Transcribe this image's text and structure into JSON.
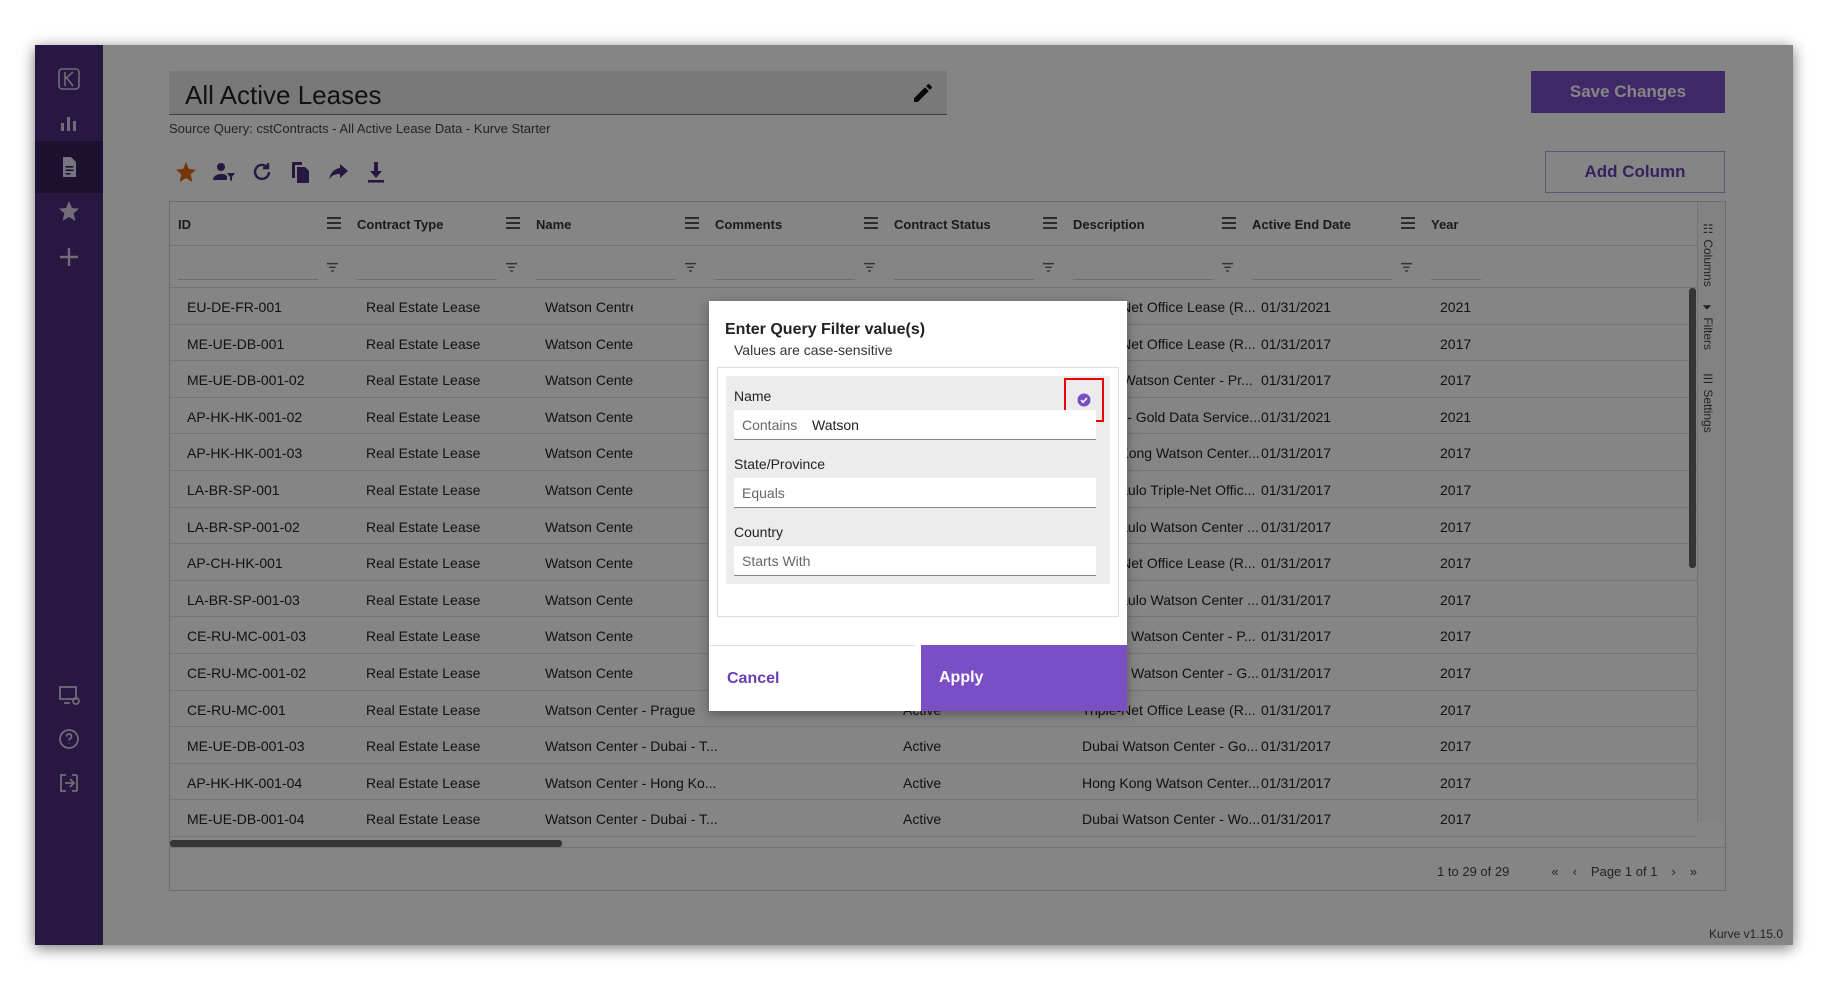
{
  "header": {
    "title": "All Active Leases",
    "source": "Source Query: cstContracts - All Active Lease Data - Kurve Starter",
    "save_label": "Save Changes",
    "add_column_label": "Add Column"
  },
  "sidebar": {
    "items": [
      {
        "icon": "logo-icon"
      },
      {
        "icon": "bar-chart-icon"
      },
      {
        "icon": "document-icon",
        "active": true
      },
      {
        "icon": "star-icon"
      },
      {
        "icon": "plus-icon"
      },
      {
        "icon": "monitor-settings-icon"
      },
      {
        "icon": "help-icon"
      },
      {
        "icon": "logout-icon"
      }
    ]
  },
  "toolbar": {
    "icons": [
      "star-icon",
      "user-filter-icon",
      "refresh-icon",
      "copy-icon",
      "share-icon",
      "download-icon"
    ],
    "accent": "#e06a10"
  },
  "grid": {
    "columns": [
      "ID",
      "Contract Type",
      "Name",
      "Comments",
      "Contract Status",
      "Description",
      "Active End Date",
      "Year"
    ],
    "rows": [
      [
        "EU-DE-FR-001",
        "Real Estate Lease",
        "Watson Centre -",
        "",
        "",
        "Triple-Net Office Lease (R...",
        "01/31/2021",
        "2021"
      ],
      [
        "ME-UE-DB-001",
        "Real Estate Lease",
        "Watson Center -",
        "",
        "",
        "Triple-Net Office Lease (R...",
        "01/31/2017",
        "2017"
      ],
      [
        "ME-UE-DB-001-02",
        "Real Estate Lease",
        "Watson Center -",
        "",
        "",
        "Dubai Watson Center - Pr...",
        "01/31/2017",
        "2017"
      ],
      [
        "AP-HK-HK-001-02",
        "Real Estate Lease",
        "Watson Center -",
        "",
        "",
        "Cnada - Gold Data Service...",
        "01/31/2021",
        "2021"
      ],
      [
        "AP-HK-HK-001-03",
        "Real Estate Lease",
        "Watson Center -",
        "",
        "",
        "Hong Kong Watson Center...",
        "01/31/2017",
        "2017"
      ],
      [
        "LA-BR-SP-001",
        "Real Estate Lease",
        "Watson Center -",
        "",
        "",
        "Sao Paulo Triple-Net Offic...",
        "01/31/2017",
        "2017"
      ],
      [
        "LA-BR-SP-001-02",
        "Real Estate Lease",
        "Watson Center -",
        "",
        "",
        "Sao Paulo Watson Center ...",
        "01/31/2017",
        "2017"
      ],
      [
        "AP-CH-HK-001",
        "Real Estate Lease",
        "Watson Center -",
        "",
        "",
        "Triple-Net Office Lease (R...",
        "01/31/2017",
        "2017"
      ],
      [
        "LA-BR-SP-001-03",
        "Real Estate Lease",
        "Watson Center -",
        "",
        "",
        "Sao Paulo Watson Center ...",
        "01/31/2017",
        "2017"
      ],
      [
        "CE-RU-MC-001-03",
        "Real Estate Lease",
        "Watson Center -",
        "",
        "",
        "Prague Watson Center - P...",
        "01/31/2017",
        "2017"
      ],
      [
        "CE-RU-MC-001-02",
        "Real Estate Lease",
        "Watson Center -",
        "",
        "",
        "Prague Watson Center - G...",
        "01/31/2017",
        "2017"
      ],
      [
        "CE-RU-MC-001",
        "Real Estate Lease",
        "Watson Center - Prague",
        "",
        "Active",
        "Triple-Net Office Lease (R...",
        "01/31/2017",
        "2017"
      ],
      [
        "ME-UE-DB-001-03",
        "Real Estate Lease",
        "Watson Center - Dubai - T...",
        "",
        "Active",
        "Dubai Watson Center - Go...",
        "01/31/2017",
        "2017"
      ],
      [
        "AP-HK-HK-001-04",
        "Real Estate Lease",
        "Watson Center - Hong Ko...",
        "",
        "Active",
        "Hong Kong Watson Center...",
        "01/31/2017",
        "2017"
      ],
      [
        "ME-UE-DB-001-04",
        "Real Estate Lease",
        "Watson Center - Dubai - T...",
        "",
        "Active",
        "Dubai Watson Center - Wo...",
        "01/31/2017",
        "2017"
      ]
    ],
    "side_tabs": [
      "Columns",
      "Filters",
      "Settings"
    ],
    "footer": {
      "range": "1 to 29 of 29",
      "page": "Page 1 of 1"
    }
  },
  "version": "Kurve v1.15.0",
  "modal": {
    "title": "Enter Query Filter value(s)",
    "subtitle": "Values are case-sensitive",
    "filters": [
      {
        "label": "Name",
        "operator": "Contains",
        "value": "Watson",
        "checked": true
      },
      {
        "label": "State/Province",
        "operator": "Equals",
        "value": ""
      },
      {
        "label": "Country",
        "operator": "Starts With",
        "value": ""
      }
    ],
    "cancel_label": "Cancel",
    "apply_label": "Apply"
  },
  "colors": {
    "sidebar": "#4e2c7c",
    "primary": "#7a4ec5",
    "highlight_box": "#e00000"
  }
}
